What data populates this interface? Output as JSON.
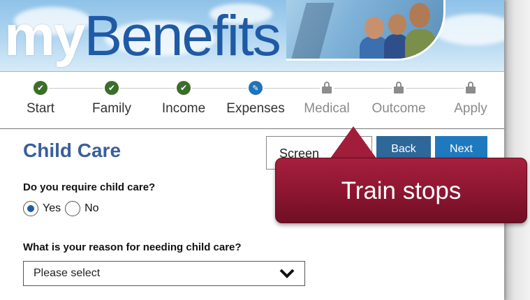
{
  "header": {
    "logo_my": "my",
    "logo_rest": "Benefits"
  },
  "steps": [
    {
      "label": "Start",
      "state": "done",
      "icon": "check-icon"
    },
    {
      "label": "Family",
      "state": "done",
      "icon": "check-icon"
    },
    {
      "label": "Income",
      "state": "done",
      "icon": "check-icon"
    },
    {
      "label": "Expenses",
      "state": "current",
      "icon": "pencil-icon"
    },
    {
      "label": "Medical",
      "state": "locked",
      "icon": "lock-icon"
    },
    {
      "label": "Outcome",
      "state": "locked",
      "icon": "lock-icon"
    },
    {
      "label": "Apply",
      "state": "locked",
      "icon": "lock-icon"
    }
  ],
  "page": {
    "title": "Child Care",
    "screener_button": "Screen",
    "back_button": "Back",
    "next_button": "Next"
  },
  "questions": {
    "q1": "Do you require child care?",
    "yes_label": "Yes",
    "no_label": "No",
    "selected": "Yes",
    "q2": "What is your reason for needing child care?",
    "select_value": "Please select"
  },
  "callout": {
    "text": "Train stops"
  },
  "colors": {
    "done": "#3c6e2a",
    "current": "#1f74b8",
    "title": "#3a5f9a",
    "callout": "#8c1530"
  }
}
